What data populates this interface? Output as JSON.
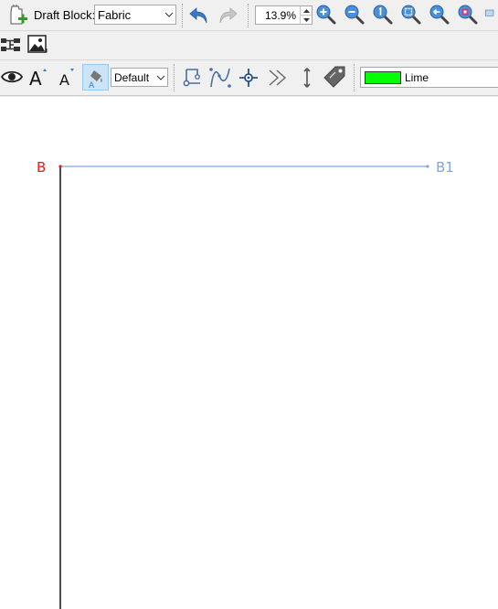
{
  "toolbar": {
    "draft_block_label": "Draft Block:",
    "draft_block_value": "Fabric",
    "zoom_value": "13.9%",
    "label_font_value": "Default",
    "line_color_name": "Lime",
    "line_color_swatch": "#00ff00"
  },
  "icons": {
    "new_draft": "new-pattern-piece-icon",
    "undo": "undo-icon",
    "redo": "redo-icon",
    "zoom_in": "zoom-in-icon",
    "zoom_out": "zoom-out-icon",
    "zoom_original": "zoom-original-icon",
    "zoom_fit_best": "zoom-fit-best-icon",
    "zoom_previous": "zoom-previous-icon",
    "zoom_to_point": "zoom-to-point-icon"
  },
  "canvas": {
    "point_b_label": "B",
    "point_b1_label": "B1",
    "point_b_color": "#e02020",
    "point_b1_color": "#7fa8e0",
    "line_color": "#7fa8e0"
  }
}
